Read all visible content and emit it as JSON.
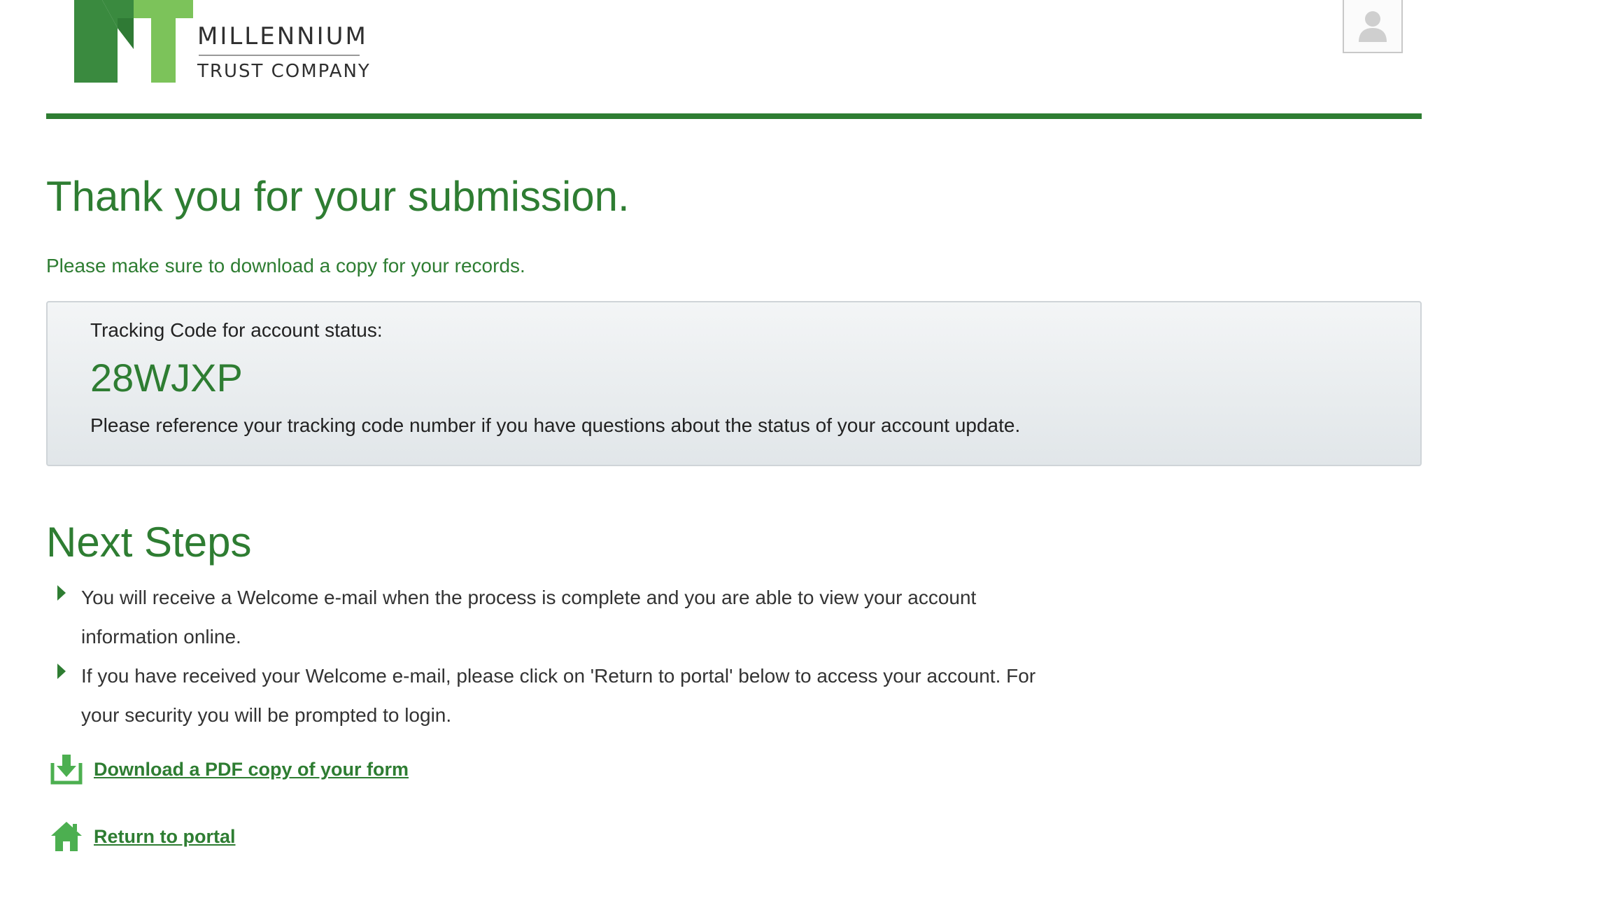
{
  "header": {
    "logo": {
      "line1": "MILLENNIUM",
      "line2": "TRUST COMPANY"
    },
    "avatar_icon": "user-avatar-icon"
  },
  "main": {
    "title": "Thank you for your submission.",
    "subtitle": "Please make sure to download a copy for your records.",
    "tracking": {
      "label": "Tracking Code for account status:",
      "code": "28WJXP",
      "note": "Please reference your tracking code number if you have questions about the status of your account update."
    },
    "next_steps": {
      "title": "Next Steps",
      "items": [
        "You will receive a Welcome e-mail when the process is complete and you are able to view your account information online.",
        "If you have received your Welcome e-mail, please click on 'Return to portal' below to access your account. For your security you will be prompted to login."
      ]
    },
    "links": {
      "download_label": "Download a PDF copy of your form",
      "download_icon": "download-icon",
      "portal_label": "Return to portal",
      "portal_icon": "home-icon"
    }
  },
  "colors": {
    "brand_green": "#2e7d32",
    "logo_dark_green": "#3a8a3f",
    "logo_light_green": "#7cc35a"
  }
}
